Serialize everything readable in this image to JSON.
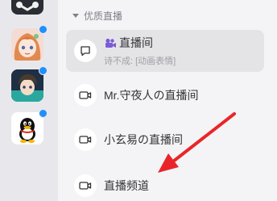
{
  "dock": {
    "items": [
      {
        "name": "top-partial-app",
        "badge": false
      },
      {
        "name": "anime-girl-avatar",
        "badge": true
      },
      {
        "name": "anime-boy-avatar",
        "badge": true
      },
      {
        "name": "penguin-avatar",
        "badge": true
      }
    ],
    "badge_color": "#1e90ff"
  },
  "section": {
    "title": "优质直播"
  },
  "channels": [
    {
      "label": "直播间",
      "subtitle": "诗不成: [动画表情]",
      "icon": "chat-bubble-icon",
      "selected": true
    },
    {
      "label": "Mr.守夜人の直播间",
      "icon": "camera-icon",
      "selected": false
    },
    {
      "label": "小玄易の直播间",
      "icon": "camera-icon",
      "selected": false
    },
    {
      "label": "直播频道",
      "icon": "camera-icon",
      "selected": false
    }
  ],
  "colors": {
    "arrow": "#e8262a",
    "live_glyph": "#7b5bd6"
  }
}
